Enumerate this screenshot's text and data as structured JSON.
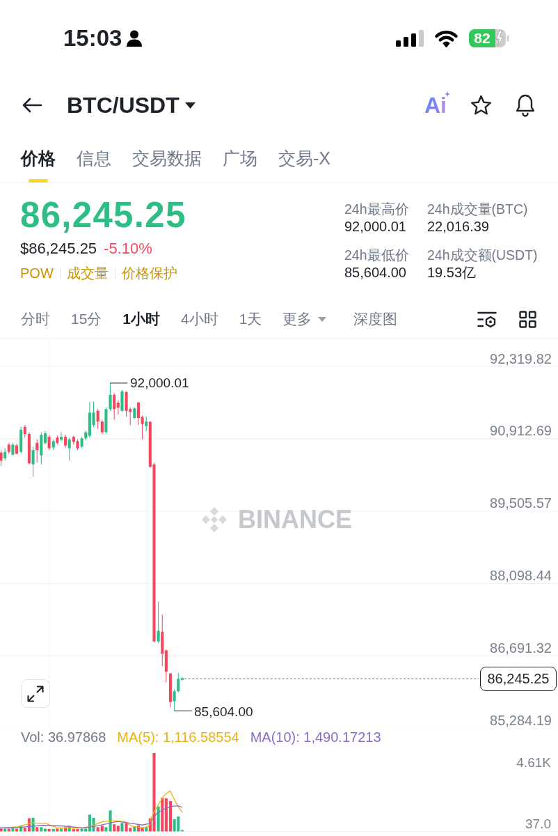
{
  "status_bar": {
    "time": "15:03",
    "battery": "82"
  },
  "header": {
    "pair": "BTC/USDT",
    "ai_label": "Ai"
  },
  "tabs": [
    {
      "label": "价格",
      "selected": true
    },
    {
      "label": "信息",
      "selected": false
    },
    {
      "label": "交易数据",
      "selected": false
    },
    {
      "label": "广场",
      "selected": false
    },
    {
      "label": "交易-X",
      "selected": false
    }
  ],
  "price": {
    "last": "86,245.25",
    "last_up": true,
    "usd": "$86,245.25",
    "change": "-5.10%",
    "change_up": false,
    "tags": [
      "POW",
      "成交量",
      "价格保护"
    ]
  },
  "stats": [
    {
      "label": "24h最高价",
      "value": "92,000.01"
    },
    {
      "label": "24h成交量(BTC)",
      "value": "22,016.39"
    },
    {
      "label": "24h最低价",
      "value": "85,604.00"
    },
    {
      "label": "24h成交额(USDT)",
      "value": "19.53亿"
    }
  ],
  "intervals": [
    {
      "label": "分时",
      "kind": "interval",
      "selected": false
    },
    {
      "label": "15分",
      "kind": "interval",
      "selected": false
    },
    {
      "label": "1小时",
      "kind": "interval",
      "selected": true
    },
    {
      "label": "4小时",
      "kind": "interval",
      "selected": false
    },
    {
      "label": "1天",
      "kind": "interval",
      "selected": false
    },
    {
      "label": "更多",
      "kind": "dropdown",
      "selected": false
    },
    {
      "label": "深度图",
      "kind": "view",
      "selected": false
    }
  ],
  "chart": {
    "watermark": "BINANCE",
    "price_ticks": [
      "92,319.82",
      "90,912.69",
      "89,505.57",
      "88,098.44",
      "86,691.32",
      "85,284.19"
    ],
    "high_label": "92,000.01",
    "low_label": "85,604.00",
    "last_price": "86,245.25"
  },
  "volume": {
    "indicators": [
      {
        "label": "Vol: 36.97868",
        "color": "#707a8a"
      },
      {
        "label": "MA(5): 1,116.58554",
        "color": "#e8b316"
      },
      {
        "label": "MA(10): 1,490.17213",
        "color": "#8d6cc9"
      }
    ],
    "ticks": [
      "4.61K",
      "37.0"
    ]
  }
}
